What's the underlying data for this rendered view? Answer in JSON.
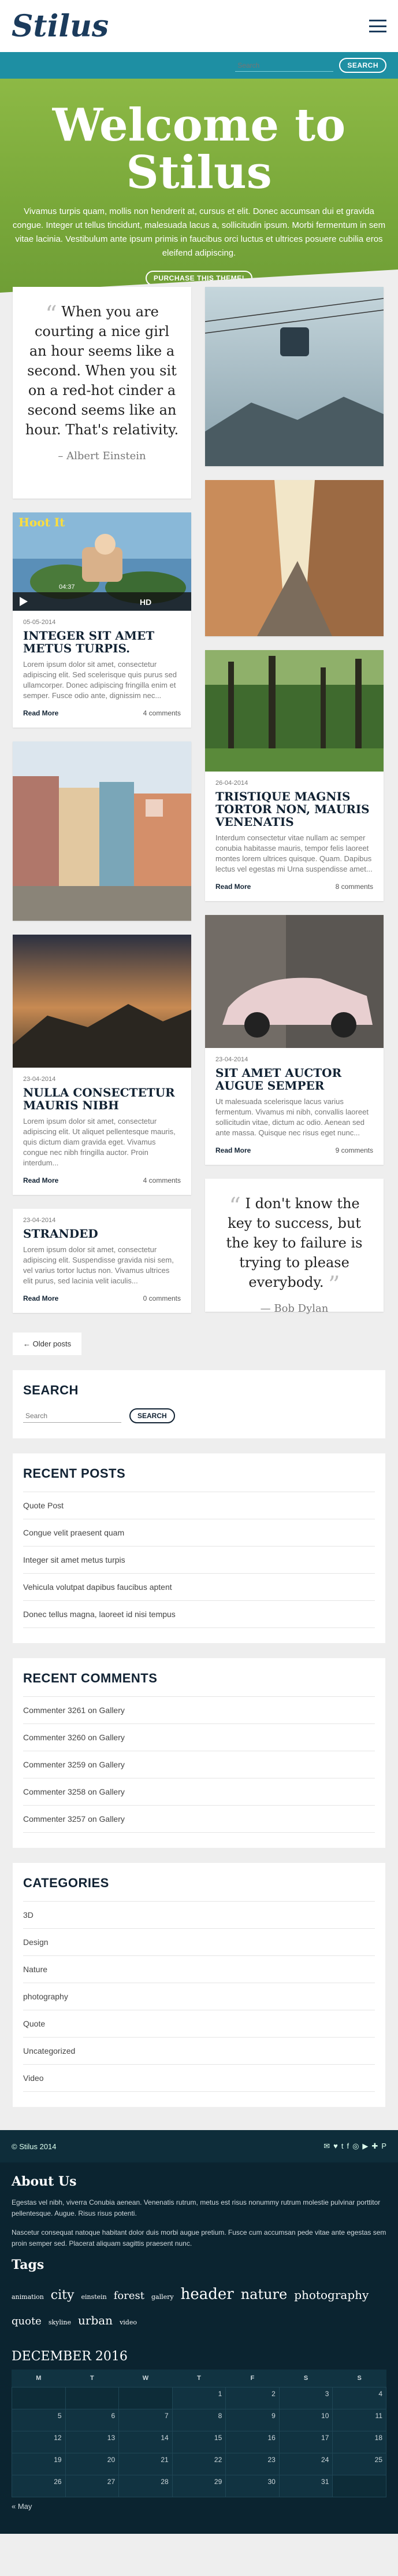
{
  "site": {
    "logo": "Stilus"
  },
  "searchbar": {
    "placeholder": "Search",
    "button": "SEARCH"
  },
  "hero": {
    "title": "Welcome to Stilus",
    "text": "Vivamus turpis quam, mollis non hendrerit at, cursus et elit. Donec accumsan dui et gravida congue. Integer ut tellus tincidunt, malesuada lacus a, sollicitudin ipsum. Morbi fermentum in sem vitae lacinia. Vestibulum ante ipsum primis in faucibus orci luctus et ultrices posuere cubilia eros eleifend adipiscing.",
    "button": "PURCHASE THIS THEME!"
  },
  "quote1": {
    "text": "When you are courting a nice girl an hour seems like a second. When you sit on a red-hot cinder a second seems like an hour. That's relativity.",
    "author": "– Albert Einstein"
  },
  "quote2": {
    "text": "I don't know the key to success, but the key to failure is trying to please everybody.",
    "author": "— Bob Dylan"
  },
  "video": {
    "title": "Hoot It",
    "duration": "04:37"
  },
  "posts": [
    {
      "date": "05-05-2014",
      "title": "INTEGER SIT AMET METUS TURPIS.",
      "excerpt": "Lorem ipsum dolor sit amet, consectetur adipiscing elit. Sed scelerisque quis purus sed ullamcorper. Donec adipiscing fringilla enim et semper. Fusce odio ante, dignissim nec...",
      "read_more": "Read More",
      "comments": "4 comments"
    },
    {
      "date": "26-04-2014",
      "title": "TRISTIQUE MAGNIS TORTOR NON, MAURIS VENENATIS",
      "excerpt": "Interdum consectetur vitae nullam ac semper conubia habitasse mauris, tempor felis laoreet montes lorem ultrices quisque. Quam. Dapibus lectus vel egestas mi Urna suspendisse amet...",
      "read_more": "Read More",
      "comments": "8 comments"
    },
    {
      "date": "23-04-2014",
      "title": "NULLA CONSECTETUR MAURIS NIBH",
      "excerpt": "Lorem ipsum dolor sit amet, consectetur adipiscing elit. Ut aliquet pellentesque mauris, quis dictum diam gravida eget. Vivamus congue nec nibh fringilla auctor. Proin interdum...",
      "read_more": "Read More",
      "comments": "4 comments"
    },
    {
      "date": "23-04-2014",
      "title": "SIT AMET AUCTOR AUGUE SEMPER",
      "excerpt": "Ut malesuada scelerisque lacus varius fermentum. Vivamus mi nibh, convallis laoreet sollicitudin vitae, dictum ac odio. Aenean sed ante massa. Quisque nec risus eget nunc...",
      "read_more": "Read More",
      "comments": "9 comments"
    },
    {
      "date": "23-04-2014",
      "title": "STRANDED",
      "excerpt": "Lorem ipsum dolor sit amet, consectetur adipiscing elit. Suspendisse gravida nisi sem, vel varius tortor luctus non. Vivamus ultrices elit purus, sed lacinia velit iaculis...",
      "read_more": "Read More",
      "comments": "0 comments"
    }
  ],
  "older_posts": "← Older posts",
  "search_widget": {
    "title": "SEARCH",
    "placeholder": "Search",
    "button": "SEARCH"
  },
  "recent_posts": {
    "title": "RECENT POSTS",
    "items": [
      "Quote Post",
      "Congue velit praesent quam",
      "Integer sit amet metus turpis",
      "Vehicula volutpat dapibus faucibus aptent",
      "Donec tellus magna, laoreet id nisi tempus"
    ]
  },
  "recent_comments": {
    "title": "RECENT COMMENTS",
    "items": [
      {
        "author": "Commenter 3261",
        "on": "on",
        "post": "Gallery"
      },
      {
        "author": "Commenter 3260",
        "on": "on",
        "post": "Gallery"
      },
      {
        "author": "Commenter 3259",
        "on": "on",
        "post": "Gallery"
      },
      {
        "author": "Commenter 3258",
        "on": "on",
        "post": "Gallery"
      },
      {
        "author": "Commenter 3257",
        "on": "on",
        "post": "Gallery"
      }
    ]
  },
  "categories": {
    "title": "CATEGORIES",
    "items": [
      "3D",
      "Design",
      "Nature",
      "photography",
      "Quote",
      "Uncategorized",
      "Video"
    ]
  },
  "footer": {
    "copyright": "© Stilus 2014",
    "social": [
      "✉",
      "♥",
      "t",
      "f",
      "◎",
      "▶",
      "✚",
      "P"
    ],
    "about_title": "About Us",
    "about_p1": "Egestas vel nibh, viverra Conubia aenean. Venenatis rutrum, metus est      risus nonummy rutrum molestie pulvinar porttitor pellentesque. Augue. Risus risus potenti.",
    "about_p2": "Nascetur consequat natoque habitant dolor duis morbi augue pretium. Fusce cum accumsan pede vitae ante egestas sem proin semper sed. Placerat aliquam sagittis praesent nunc.",
    "tags_title": "Tags",
    "tags": [
      {
        "name": "animation",
        "size": 11
      },
      {
        "name": "city",
        "size": 22
      },
      {
        "name": "einstein",
        "size": 11
      },
      {
        "name": "forest",
        "size": 18
      },
      {
        "name": "gallery",
        "size": 11
      },
      {
        "name": "header",
        "size": 26
      },
      {
        "name": "nature",
        "size": 24
      },
      {
        "name": "photography",
        "size": 20
      },
      {
        "name": "quote",
        "size": 18
      },
      {
        "name": "skyline",
        "size": 11
      },
      {
        "name": "urban",
        "size": 20
      },
      {
        "name": "video",
        "size": 11
      }
    ],
    "calendar_title": "DECEMBER 2016",
    "weekdays": [
      "M",
      "T",
      "W",
      "T",
      "F",
      "S",
      "S"
    ],
    "weeks": [
      [
        "",
        "",
        "",
        "1",
        "2",
        "3",
        "4"
      ],
      [
        "5",
        "6",
        "7",
        "8",
        "9",
        "10",
        "11"
      ],
      [
        "12",
        "13",
        "14",
        "15",
        "16",
        "17",
        "18"
      ],
      [
        "19",
        "20",
        "21",
        "22",
        "23",
        "24",
        "25"
      ],
      [
        "26",
        "27",
        "28",
        "29",
        "30",
        "31",
        ""
      ]
    ],
    "prev_month": "« May"
  }
}
